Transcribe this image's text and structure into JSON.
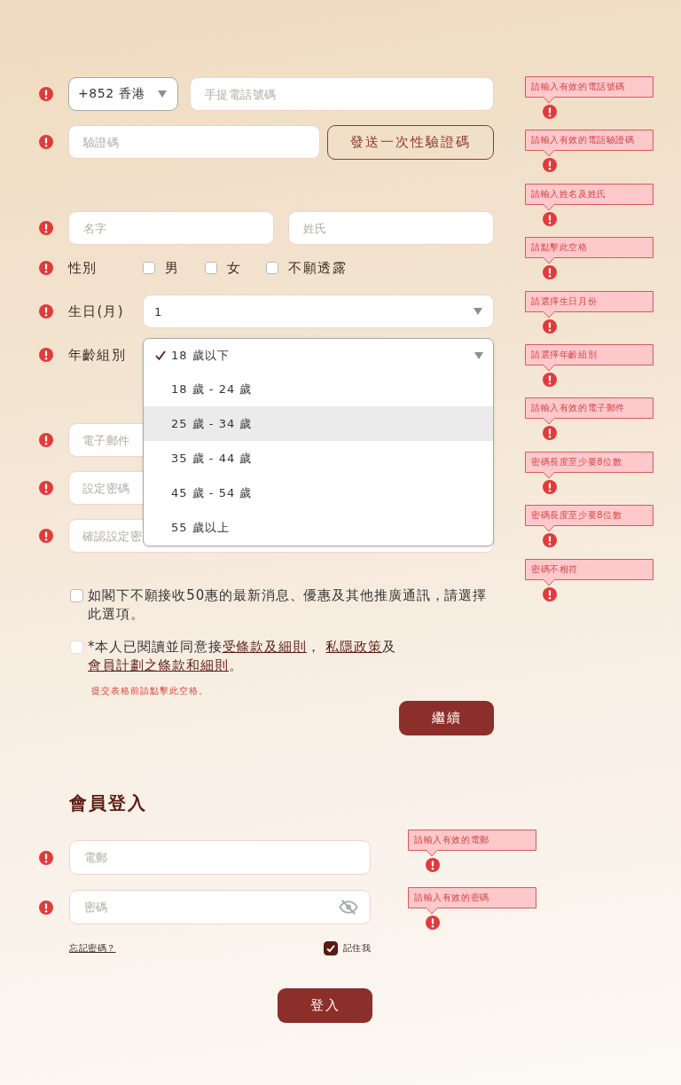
{
  "registration": {
    "rows": [
      {
        "kind": "phone",
        "error": true,
        "country": "+852 香港",
        "placeholder": "手提電話號碼"
      },
      {
        "kind": "verification",
        "error": true,
        "placeholder": "驗證碼",
        "button": "發送一次性驗證碼"
      },
      {
        "kind": "name",
        "error": true,
        "first_placeholder": "名字",
        "last_placeholder": "姓氏"
      },
      {
        "kind": "choice",
        "error": true,
        "label": "性別",
        "options": [
          {
            "label": "男",
            "checked": false
          },
          {
            "label": "女",
            "checked": false
          },
          {
            "label": "不願透露",
            "checked": false
          }
        ]
      },
      {
        "kind": "select",
        "error": true,
        "label": "生日(月)",
        "value": "1"
      },
      {
        "kind": "dropdown",
        "error": true,
        "label": "年齡組別",
        "expanded": true,
        "options": [
          {
            "label": "18 歲以下",
            "selected": true,
            "highlighted": false
          },
          {
            "label": "18 歲 - 24 歲",
            "selected": false,
            "highlighted": false
          },
          {
            "label": "25 歲 - 34 歲",
            "selected": false,
            "highlighted": true
          },
          {
            "label": "35 歲 - 44 歲",
            "selected": false,
            "highlighted": false
          },
          {
            "label": "45 歲 - 54 歲",
            "selected": false,
            "highlighted": false
          },
          {
            "label": "55 歲以上",
            "selected": false,
            "highlighted": false
          }
        ]
      },
      {
        "kind": "text",
        "error": true,
        "placeholder": "電子郵件"
      },
      {
        "kind": "text",
        "error": true,
        "placeholder": "設定密碼"
      },
      {
        "kind": "text",
        "error": true,
        "placeholder": "確認設定密"
      }
    ],
    "newsletter_opt_out": {
      "checked": false,
      "text": "如閣下不願接收50惠的最新消息、優惠及其他推廣通訊，請選擇此選項。"
    },
    "terms_consent": {
      "checked": false,
      "segments": [
        {
          "kind": "text",
          "text": "*本人已閱讀並同意接"
        },
        {
          "kind": "link",
          "text": "受條款及細則"
        },
        {
          "kind": "text",
          "text": "， "
        },
        {
          "kind": "link",
          "text": "私隱政策"
        },
        {
          "kind": "text",
          "text": "及"
        },
        {
          "kind": "link",
          "text": "會員計劃之條款和細則"
        },
        {
          "kind": "text",
          "text": "。"
        }
      ]
    },
    "terms_error": "提交表格前請點擊此空格。",
    "continue_button": "繼續",
    "error_tooltips": [
      {
        "message": "請輸入有效的電話號碼"
      },
      {
        "message": "請輸入有效的電話驗證碼"
      },
      {
        "message": "請輸入姓名及姓氏"
      },
      {
        "message": "請點擊此空格"
      },
      {
        "message": "請選擇生日月份"
      },
      {
        "message": "請選擇年齡組別"
      },
      {
        "message": "請輸入有效的電子郵件"
      },
      {
        "message": "密碼長度至少要8位數"
      },
      {
        "message": "密碼長度至少要8位數"
      },
      {
        "message": "密碼不相符"
      }
    ]
  },
  "login": {
    "title": "會員登入",
    "email_field": {
      "placeholder": "電郵",
      "error": true
    },
    "password_field": {
      "placeholder": "密碼",
      "error": true
    },
    "forgot_password_link": "忘記密碼？",
    "remember_me": {
      "label": "記住我",
      "checked": true
    },
    "login_button": "登入",
    "error_tooltips": [
      {
        "message": "請輸入有效的電郵"
      },
      {
        "message": "請輸入有效的密碼"
      }
    ]
  }
}
